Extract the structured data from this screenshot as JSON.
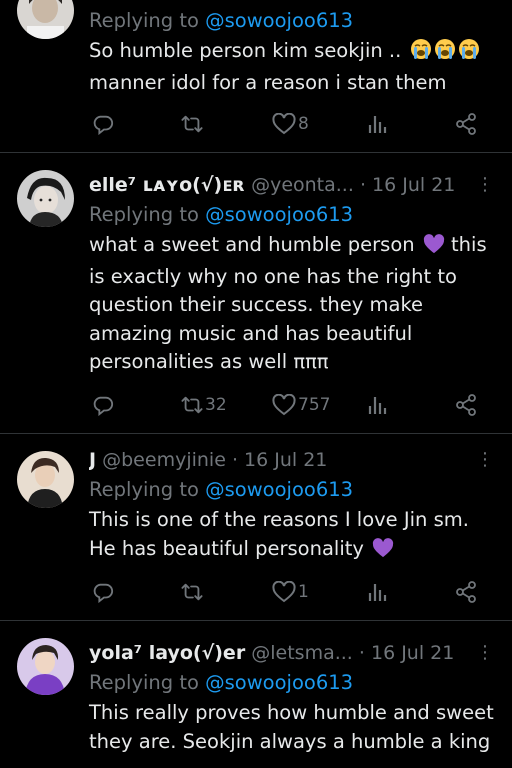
{
  "tweets": [
    {
      "display_name": "",
      "handle": "",
      "date": "",
      "replying_label": "Replying to",
      "replying_to": "@sowoojoo613",
      "text": "So humble person kim seokjin .. ",
      "text2": "manner idol for a reason i stan them",
      "emoji": [
        "loudly-crying-face",
        "loudly-crying-face",
        "loudly-crying-face"
      ],
      "stats": {
        "replies": "",
        "retweets": "",
        "likes": "8",
        "views": ""
      }
    },
    {
      "display_name": "elle⁷ ʟᴀʏᴏ(√)ᴇʀ",
      "handle": "@yeonta...",
      "dot": "·",
      "date": "16 Jul 21",
      "replying_label": "Replying to",
      "replying_to": "@sowoojoo613",
      "text_a": "what a sweet and humble person ",
      "text_b": " this is exactly why no one has the right to question their success. they make amazing music and has beautiful personalities as well πππ",
      "emoji": [
        "purple-heart"
      ],
      "stats": {
        "replies": "",
        "retweets": "32",
        "likes": "757",
        "views": ""
      }
    },
    {
      "display_name": "J",
      "handle": "@beemyjinie",
      "dot": "·",
      "date": "16 Jul 21",
      "replying_label": "Replying to",
      "replying_to": "@sowoojoo613",
      "text": "This is one of the reasons I love Jin sm. He has beautiful personality ",
      "emoji": [
        "purple-heart"
      ],
      "stats": {
        "replies": "",
        "retweets": "",
        "likes": "1",
        "views": ""
      }
    },
    {
      "display_name": "yola⁷ layo(√)er",
      "handle": "@letsma...",
      "dot": "·",
      "date": "16 Jul 21",
      "replying_label": "Replying to",
      "replying_to": "@sowoojoo613",
      "text": "This really proves how humble and sweet they are. Seokjin always a humble a king"
    }
  ],
  "colors": {
    "background": "#000000",
    "text": "#e7e9ea",
    "secondary": "#71767b",
    "link": "#1d9bf0",
    "divider": "#2f3336"
  },
  "icons": [
    "reply-icon",
    "retweet-icon",
    "like-icon",
    "views-icon",
    "share-icon",
    "more-icon"
  ]
}
